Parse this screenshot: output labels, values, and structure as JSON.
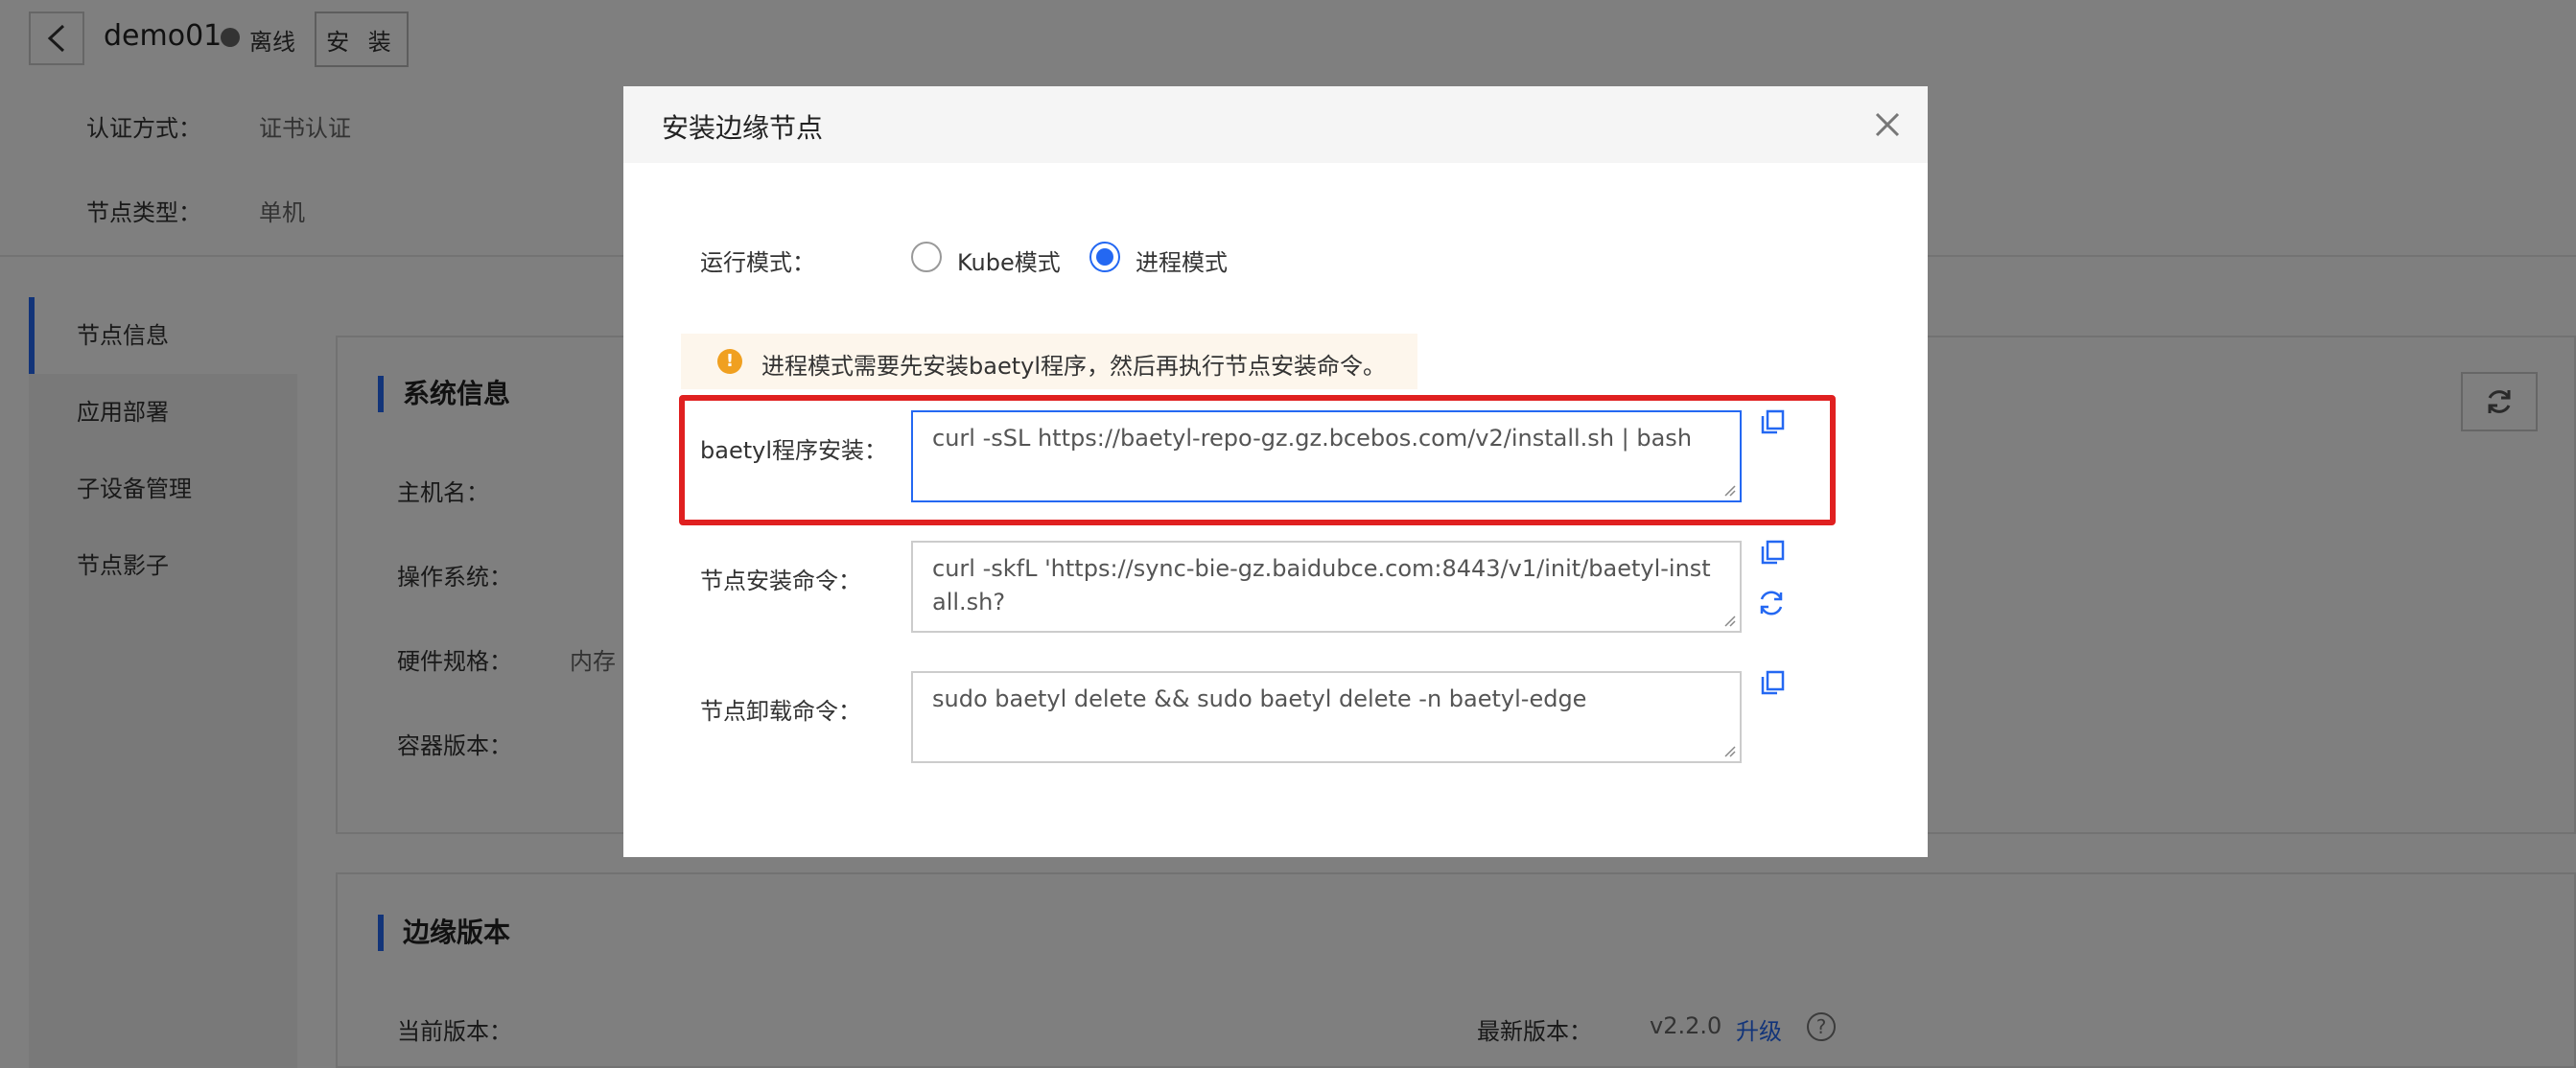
{
  "header": {
    "node_name": "demo01",
    "status": "离线",
    "install_button": "安 装"
  },
  "info": {
    "auth_label": "认证方式：",
    "auth_value": "证书认证",
    "type_label": "节点类型：",
    "type_value": "单机"
  },
  "sidebar": {
    "items": [
      {
        "label": "节点信息"
      },
      {
        "label": "应用部署"
      },
      {
        "label": "子设备管理"
      },
      {
        "label": "节点影子"
      }
    ]
  },
  "system_card": {
    "title": "系统信息",
    "hostname_label": "主机名：",
    "os_label": "操作系统：",
    "hardware_label": "硬件规格：",
    "hardware_value": "内存",
    "container_label": "容器版本："
  },
  "version_card": {
    "title": "边缘版本",
    "current_label": "当前版本：",
    "latest_label": "最新版本：",
    "latest_value": "v2.2.0",
    "upgrade_link": "升级",
    "help": "?"
  },
  "modal": {
    "title": "安装边缘节点",
    "run_mode_label": "运行模式：",
    "options": [
      {
        "label": "Kube模式",
        "checked": false
      },
      {
        "label": "进程模式",
        "checked": true
      }
    ],
    "tip": "进程模式需要先安装baetyl程序，然后再执行节点安装命令。",
    "baetyl_install_label": "baetyl程序安装：",
    "baetyl_install_cmd": "curl -sSL https://baetyl-repo-gz.gz.bcebos.com/v2/install.sh | bash",
    "node_install_label": "节点安装命令：",
    "node_install_cmd": "curl -skfL 'https://sync-bie-gz.baidubce.com:8443/v1/init/baetyl-install.sh?",
    "node_uninstall_label": "节点卸载命令：",
    "node_uninstall_cmd": "sudo baetyl delete && sudo baetyl delete -n baetyl-edge"
  },
  "colors": {
    "accent": "#2468f2",
    "highlight": "#e02020",
    "warning": "#f0a020"
  }
}
